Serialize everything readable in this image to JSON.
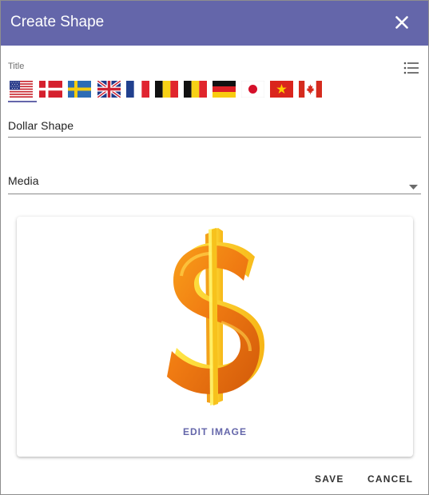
{
  "dialog": {
    "title": "Create Shape",
    "close_icon": "close-icon"
  },
  "form": {
    "title_label": "Title",
    "list_icon": "list-icon",
    "flags": [
      {
        "name": "flag-us-icon",
        "selected": true
      },
      {
        "name": "flag-denmark-icon"
      },
      {
        "name": "flag-sweden-icon"
      },
      {
        "name": "flag-uk-icon"
      },
      {
        "name": "flag-france-icon"
      },
      {
        "name": "flag-belgium-icon"
      },
      {
        "name": "flag-belgium-icon"
      },
      {
        "name": "flag-germany-icon"
      },
      {
        "name": "flag-japan-icon"
      },
      {
        "name": "flag-vietnam-icon"
      },
      {
        "name": "flag-canada-icon"
      }
    ],
    "name_value": "Dollar Shape",
    "media_value": "Media",
    "media_arrow_icon": "dropdown-arrow-icon"
  },
  "card": {
    "image_icon": "dollar-sign-image",
    "edit_label": "EDIT IMAGE"
  },
  "actions": {
    "save_label": "SAVE",
    "cancel_label": "CANCEL"
  },
  "colors": {
    "header": "#6466aa",
    "accent": "#6466aa"
  }
}
